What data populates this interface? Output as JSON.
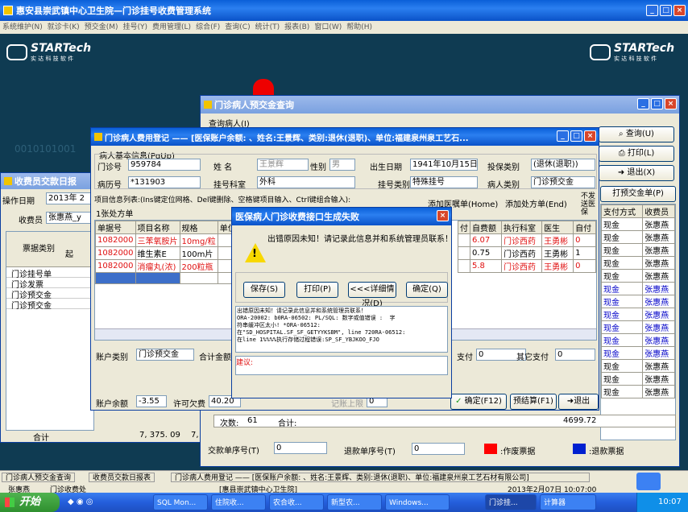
{
  "main_title": "惠安县崇武镇中心卫生院—门诊挂号收费管理系统",
  "menu": [
    "系统维护(N)",
    "就诊卡(K)",
    "预交金(M)",
    "挂号(Y)",
    "费用管理(L)",
    "综合(F)",
    "查询(C)",
    "统计(T)",
    "报表(B)",
    "窗口(W)",
    "帮助(H)"
  ],
  "logo_text": "STARTech",
  "logo_sub": "实 达 科 技 软 件",
  "bg_digits": "0010101001",
  "prepay_window": {
    "title": "门诊病人预交金查询",
    "sub": "查询病人(I)",
    "btns": [
      "查询(U)",
      "打印(L)",
      "退出(X)"
    ],
    "prepay_btn": "打预交金单(P)",
    "cols": [
      "支付方式",
      "收费员"
    ],
    "rows": [
      [
        "现金",
        "张惠燕"
      ],
      [
        "现金",
        "张惠燕"
      ],
      [
        "现金",
        "张惠燕"
      ],
      [
        "现金",
        "张惠燕"
      ],
      [
        "现金",
        "张惠燕"
      ],
      [
        "现金",
        "张惠燕"
      ],
      [
        "现金",
        "张惠燕"
      ],
      [
        "现金",
        "张惠燕"
      ],
      [
        "现金",
        "张惠燕"
      ],
      [
        "现金",
        "张惠燕"
      ],
      [
        "现金",
        "张惠燕"
      ],
      [
        "现金",
        "张惠燕"
      ],
      [
        "现金",
        "张惠燕"
      ],
      [
        "现金",
        "张惠燕"
      ]
    ],
    "amount": "4699.72",
    "refund_no_label": "退款单序号(T)",
    "refund_no": "0",
    "void_legend": ":作废票据",
    "refund_legend": ":退款票据",
    "count_label": "次数:",
    "count": "61",
    "total_label": "合计:"
  },
  "cashier_window": {
    "title": "收费员交款日报",
    "date_label": "操作日期",
    "date": "2013年 2",
    "cashier_label": "收费员",
    "cashier": "张惠燕_y",
    "col_type": "票据类别",
    "col_start": "起",
    "rows": [
      "门诊挂号单",
      "门诊发票",
      "门诊预交金",
      "门诊预交金"
    ],
    "sum_label": "合计",
    "sum_value": "7, 375. 09",
    "sum_value2": "7, 37"
  },
  "fee_window": {
    "title": "门诊病人费用登记 —— [医保账户余额: 、姓名:王景辉、类别:退休(退职)、单位:福建泉州泉工艺石...",
    "basic_label": "病人基本信息(PgUp)",
    "clinic_no_label": "门诊号",
    "clinic_no": "959784",
    "name_label": "姓    名",
    "name": "王景辉",
    "sex_label": "性别",
    "sex": "男",
    "birth_label": "出生日期",
    "birth": "1941年10月15日",
    "insure_label": "投保类别",
    "insure": "(退休(退职))",
    "record_label": "病历号",
    "record": "*131903",
    "dept_label": "挂号科室",
    "dept": "外科",
    "reg_type_label": "挂号类别",
    "reg_type": "特殊挂号",
    "ptype_label": "病人类别",
    "ptype": "门诊预交金",
    "items_hint": "项目信息列表:(Ins键定位网格、Del键删除、空格键项目输入、Ctrl键组合输入):",
    "add_med": "添加医嘱单(Home)",
    "add_rx": "添加处方单(End)",
    "no_send": "不发送医保",
    "rx_count": "1张处方单",
    "cols": [
      "单据号",
      "项目名称",
      "规格",
      "单位"
    ],
    "rows": [
      {
        "no": "1082000",
        "name": "三苯氧胺片",
        "spec": "10mg/粒"
      },
      {
        "no": "1082000",
        "name": "维生素E",
        "spec": "100m片"
      },
      {
        "no": "1082000",
        "name": "消瘤丸(浓)",
        "spec": "200粒瓶"
      }
    ],
    "right_cols": [
      "付",
      "自费额",
      "执行科室",
      "医生",
      "自付"
    ],
    "right_rows": [
      [
        "",
        "6.07",
        "门诊西药",
        "王勇彬",
        "0"
      ],
      [
        "",
        "0.75",
        "门诊西药",
        "王勇彬",
        "1"
      ],
      [
        "",
        "5.8",
        "门诊西药",
        "王勇彬",
        "0"
      ]
    ],
    "acct_type_label": "账户类别",
    "acct_type": "门诊预交金",
    "total_label": "合计金额",
    "pay_label": "支付",
    "pay": "0",
    "other_pay_label": "其它支付",
    "other_pay": "0",
    "balance_label": "账户余额",
    "balance": "-3.55",
    "overdraft_label": "许可欠费",
    "overdraft": "40.20",
    "limit_label": "记账上限",
    "limit": "0",
    "confirm_btn": "确定(F12)",
    "presettle_btn": "预结算(F1)",
    "exit_btn": "退出(Esc)"
  },
  "dialog": {
    "title": "医保病人门诊收费接口生成失败",
    "message": "出错原因未知！请记录此信息并和系统管理员联系！",
    "buttons": [
      "保存(S)",
      "打印(P)",
      "<<<详细情况(D)",
      "确定(Q)"
    ],
    "detail": "出错原因未知！请记录此信息并和系统管理员联系！\nORA-20002: b0RA-06502: PL/SQL: 数字或值错误 :  字\n符串缓冲区太小! *ORA-06512:\n在\"SD_HOSPITAL.SF_SF_GETYYKSBM\", line 720RA-06512:\n在line 1%%%%执行存储过程错误:SP_SF_YBJKOO_FJO",
    "suggest_label": "建议:"
  },
  "status_tabs": [
    "门诊病人预交金查询",
    "收费员交款日报表",
    "门诊病人费用登记 —— [医保账户余额: 、姓名:王景辉、类别:退休(退职)、单位:福建泉州泉工艺石材有限公司]"
  ],
  "status_row2": [
    "张惠燕",
    "门诊收费处",
    "[惠县崇武镇中心卫生院]",
    "2013年2月07日 10:07:00"
  ],
  "taskbar": {
    "start": "开始",
    "items": [
      "SQL Mon...",
      "住院收...",
      "农合收...",
      "新型农...",
      "Windows...",
      "门诊挂...",
      "计算器"
    ],
    "time": "10:07"
  }
}
